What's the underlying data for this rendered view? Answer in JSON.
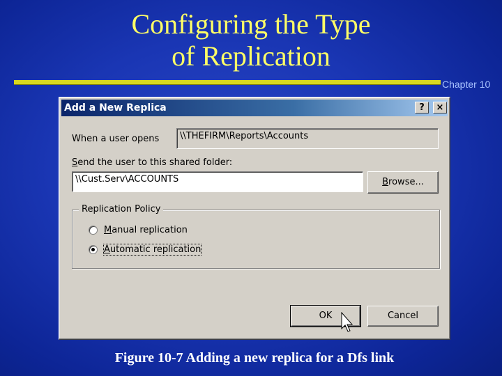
{
  "slide": {
    "title_line1": "Configuring the Type",
    "title_line2": "of Replication",
    "chapter": "Chapter 10",
    "caption": "Figure 10-7  Adding a new replica for a Dfs link",
    "colors": {
      "title": "#ffff66",
      "rule": "#d8d820",
      "background": "#1a36b4"
    }
  },
  "dialog": {
    "title": "Add a New Replica",
    "help_button": "?",
    "close_button": "×",
    "when_label": "When a user opens",
    "when_value": "\\\\THEFIRM\\Reports\\Accounts",
    "send_label_mnemonic": "S",
    "send_label_rest": "end the user to this shared folder:",
    "send_value": "\\\\Cust.Serv\\ACCOUNTS",
    "browse_mnemonic": "B",
    "browse_rest": "rowse...",
    "group_label": "Replication Policy",
    "radio_manual_mnemonic": "M",
    "radio_manual_rest": "anual replication",
    "radio_auto_mnemonic": "A",
    "radio_auto_rest": "utomatic replication",
    "selected_policy": "automatic",
    "ok_label": "OK",
    "cancel_label": "Cancel"
  }
}
